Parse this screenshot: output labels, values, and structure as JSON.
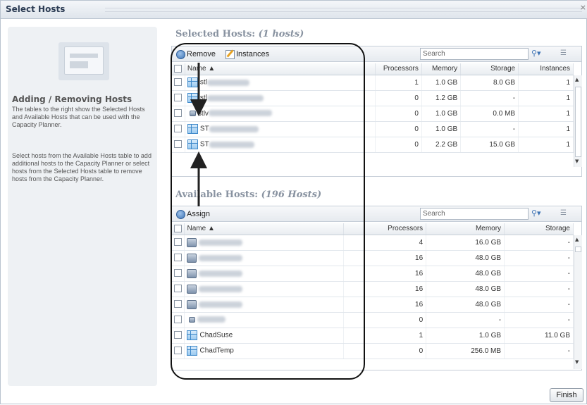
{
  "dialog": {
    "title": "Select Hosts"
  },
  "help": {
    "heading": "Adding / Removing Hosts",
    "paragraph1": "The tables to the right show the Selected Hosts and Available Hosts that can be used with the Capacity Planner.",
    "paragraph2": "Select hosts from the Available Hosts table to add additional hosts to the Capacity Planner or select hosts from the Selected Hosts table to remove hosts from the Capacity Planner."
  },
  "selected": {
    "title": "Selected Hosts:",
    "count": "(1 hosts)",
    "remove_label": "Remove",
    "instances_label": "Instances",
    "search_placeholder": "Search",
    "columns": {
      "name": "Name ▲",
      "processors": "Processors",
      "memory": "Memory",
      "storage": "Storage",
      "instances": "Instances"
    },
    "rows": [
      {
        "name": "stl",
        "processors": "1",
        "memory": "1.0 GB",
        "storage": "8.0 GB",
        "instances": "1"
      },
      {
        "name": "stl",
        "processors": "0",
        "memory": "1.2 GB",
        "storage": "-",
        "instances": "1"
      },
      {
        "name": "stlv",
        "processors": "0",
        "memory": "1.0 GB",
        "storage": "0.0 MB",
        "instances": "1"
      },
      {
        "name": "ST",
        "processors": "0",
        "memory": "1.0 GB",
        "storage": "-",
        "instances": "1"
      },
      {
        "name": "ST",
        "processors": "0",
        "memory": "2.2 GB",
        "storage": "15.0 GB",
        "instances": "1"
      }
    ]
  },
  "available": {
    "title": "Available Hosts:",
    "count": "(196 Hosts)",
    "assign_label": "Assign",
    "search_placeholder": "Search",
    "columns": {
      "name": "Name ▲",
      "processors": "Processors",
      "memory": "Memory",
      "storage": "Storage"
    },
    "rows": [
      {
        "name": "",
        "processors": "4",
        "memory": "16.0 GB",
        "storage": "-"
      },
      {
        "name": "",
        "processors": "16",
        "memory": "48.0 GB",
        "storage": "-"
      },
      {
        "name": "",
        "processors": "16",
        "memory": "48.0 GB",
        "storage": "-"
      },
      {
        "name": "",
        "processors": "16",
        "memory": "48.0 GB",
        "storage": "-"
      },
      {
        "name": "",
        "processors": "16",
        "memory": "48.0 GB",
        "storage": "-"
      },
      {
        "name": "",
        "processors": "0",
        "memory": "-",
        "storage": "-"
      },
      {
        "name": "ChadSuse",
        "processors": "1",
        "memory": "1.0 GB",
        "storage": "11.0 GB"
      },
      {
        "name": "ChadTemp",
        "processors": "0",
        "memory": "256.0 MB",
        "storage": "-"
      }
    ]
  },
  "finish_label": "Finish"
}
